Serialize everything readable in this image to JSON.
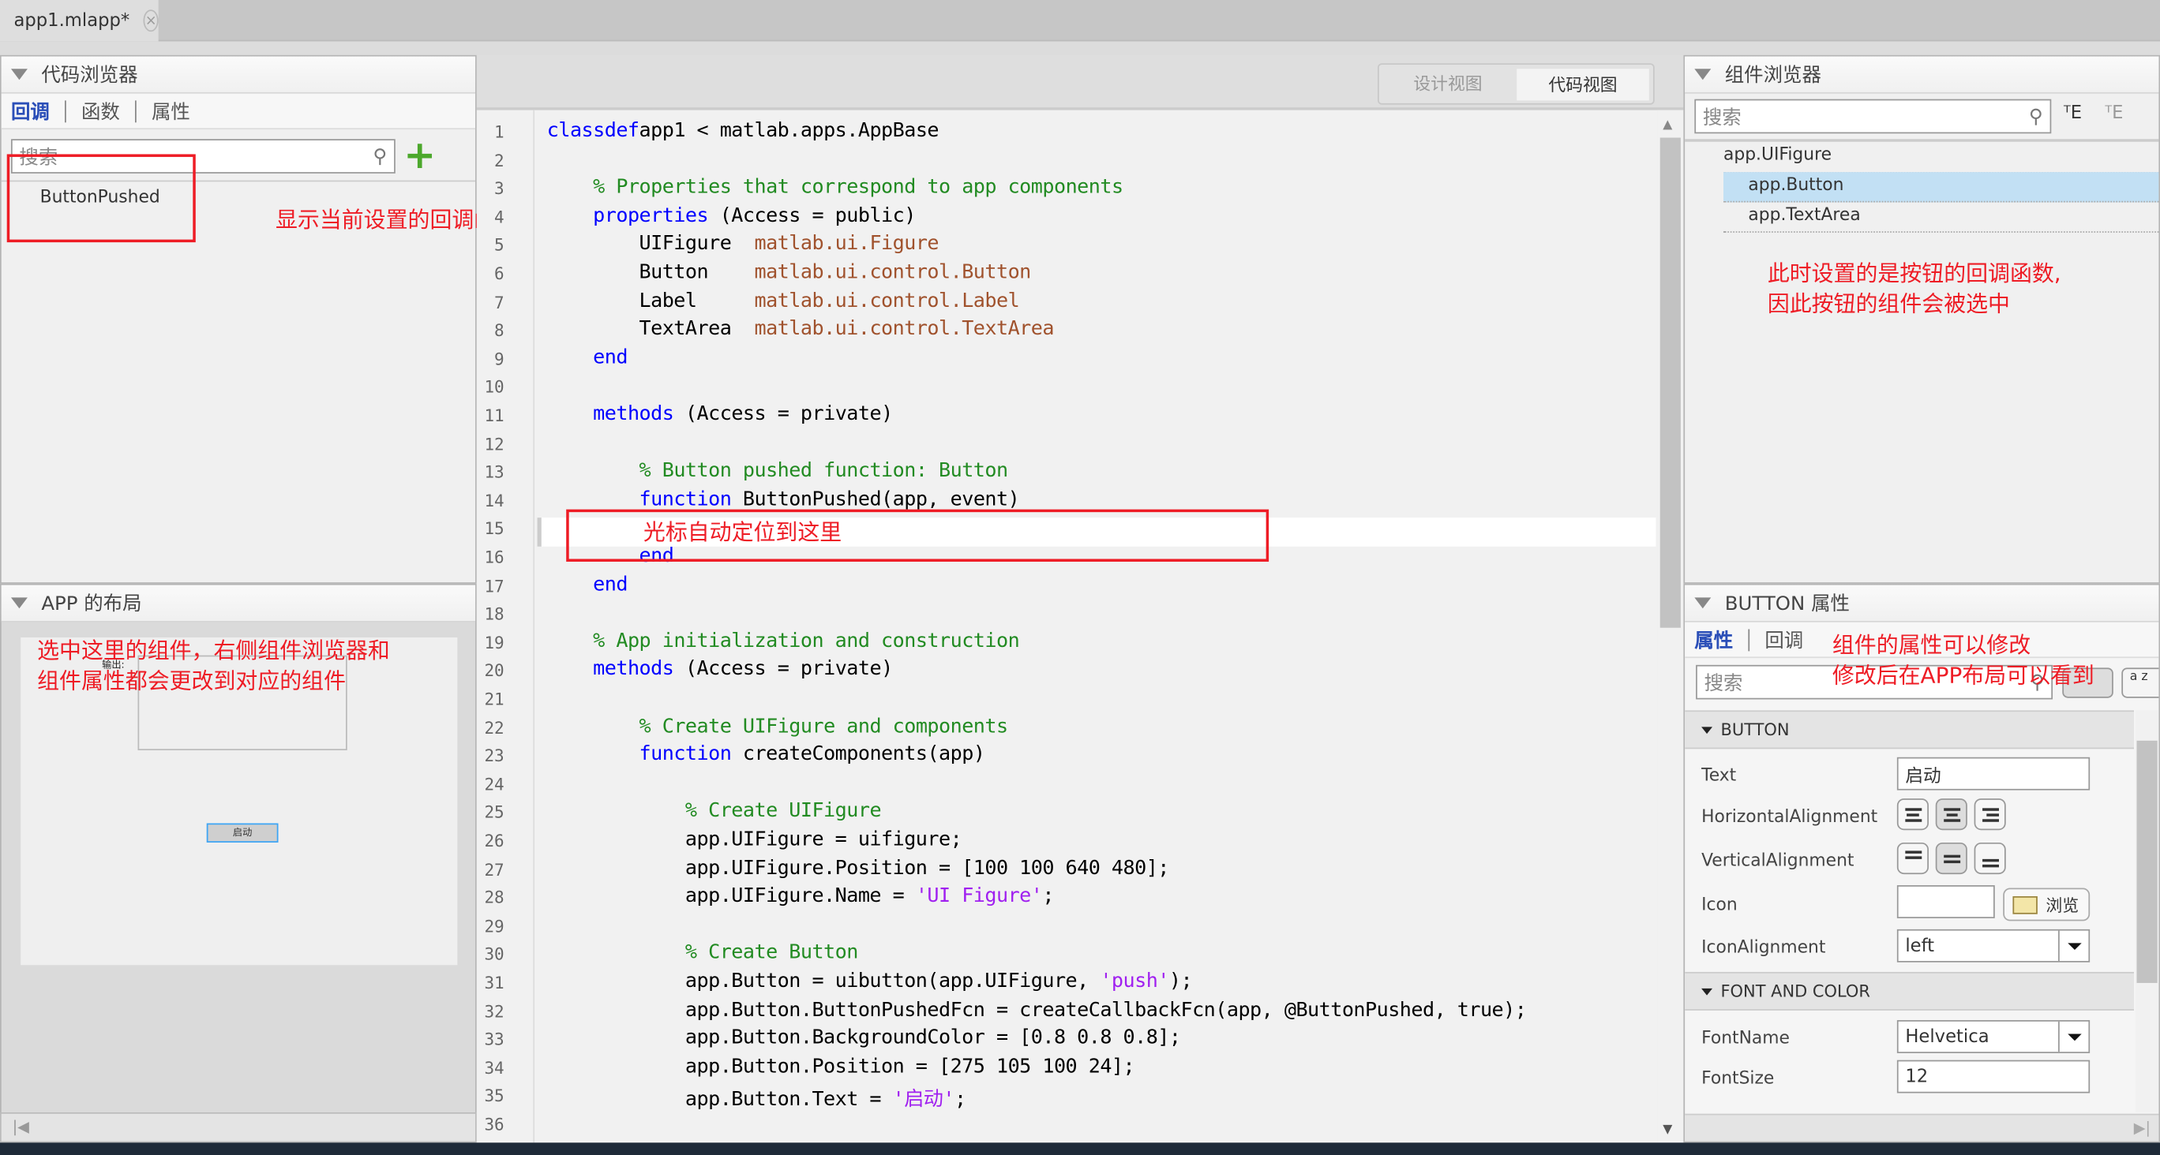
{
  "tab": {
    "title": "app1.mlapp*",
    "close": "×"
  },
  "code_browser": {
    "title": "代码浏览器",
    "tabs": [
      "回调",
      "函数",
      "属性"
    ],
    "search_placeholder": "搜索",
    "items": [
      "ButtonPushed"
    ],
    "add": "+"
  },
  "layout_panel": {
    "title": "APP 的布局",
    "label": "输出:",
    "button": "启动"
  },
  "view_toggle": {
    "design": "设计视图",
    "code": "代码视图"
  },
  "code": [
    [
      [
        "kw",
        "classdef"
      ],
      [
        "",
        "app1 < matlab.apps.AppBase"
      ]
    ],
    [],
    [
      [
        "",
        "    "
      ],
      [
        "cm",
        "% Properties that correspond to app components"
      ]
    ],
    [
      [
        "",
        "    "
      ],
      [
        "kw",
        "properties"
      ],
      [
        "",
        " (Access = public)"
      ]
    ],
    [
      [
        "",
        "        UIFigure  "
      ],
      [
        "ty",
        "matlab.ui.Figure"
      ]
    ],
    [
      [
        "",
        "        Button    "
      ],
      [
        "ty",
        "matlab.ui.control.Button"
      ]
    ],
    [
      [
        "",
        "        Label     "
      ],
      [
        "ty",
        "matlab.ui.control.Label"
      ]
    ],
    [
      [
        "",
        "        TextArea  "
      ],
      [
        "ty",
        "matlab.ui.control.TextArea"
      ]
    ],
    [
      [
        "",
        "    "
      ],
      [
        "kw",
        "end"
      ]
    ],
    [],
    [
      [
        "",
        "    "
      ],
      [
        "kw",
        "methods"
      ],
      [
        "",
        " (Access = private)"
      ]
    ],
    [],
    [
      [
        "",
        "        "
      ],
      [
        "cm",
        "% Button pushed function: Button"
      ]
    ],
    [
      [
        "",
        "        "
      ],
      [
        "kw",
        "function"
      ],
      [
        "",
        " ButtonPushed(app, event)"
      ]
    ],
    [
      [
        "",
        "            "
      ]
    ],
    [
      [
        "",
        "        "
      ],
      [
        "kw",
        "end"
      ]
    ],
    [
      [
        "",
        "    "
      ],
      [
        "kw",
        "end"
      ]
    ],
    [],
    [
      [
        "",
        "    "
      ],
      [
        "cm",
        "% App initialization and construction"
      ]
    ],
    [
      [
        "",
        "    "
      ],
      [
        "kw",
        "methods"
      ],
      [
        "",
        " (Access = private)"
      ]
    ],
    [],
    [
      [
        "",
        "        "
      ],
      [
        "cm",
        "% Create UIFigure and components"
      ]
    ],
    [
      [
        "",
        "        "
      ],
      [
        "kw",
        "function"
      ],
      [
        "",
        " createComponents(app)"
      ]
    ],
    [],
    [
      [
        "",
        "            "
      ],
      [
        "cm",
        "% Create UIFigure"
      ]
    ],
    [
      [
        "",
        "            app.UIFigure = uifigure;"
      ]
    ],
    [
      [
        "",
        "            app.UIFigure.Position = [100 100 640 480];"
      ]
    ],
    [
      [
        "",
        "            app.UIFigure.Name = "
      ],
      [
        "st",
        "'UI Figure'"
      ],
      [
        "",
        ";"
      ]
    ],
    [],
    [
      [
        "",
        "            "
      ],
      [
        "cm",
        "% Create Button"
      ]
    ],
    [
      [
        "",
        "            app.Button = uibutton(app.UIFigure, "
      ],
      [
        "st",
        "'push'"
      ],
      [
        "",
        ");"
      ]
    ],
    [
      [
        "",
        "            app.Button.ButtonPushedFcn = createCallbackFcn(app, @ButtonPushed, true);"
      ]
    ],
    [
      [
        "",
        "            app.Button.BackgroundColor = [0.8 0.8 0.8];"
      ]
    ],
    [
      [
        "",
        "            app.Button.Position = [275 105 100 24];"
      ]
    ],
    [
      [
        "",
        "            app.Button.Text = "
      ],
      [
        "st",
        "'启动'"
      ],
      [
        "",
        ";"
      ]
    ],
    []
  ],
  "component_browser": {
    "title": "组件浏览器",
    "search_placeholder": "搜索",
    "tree": [
      "app.UIFigure",
      "app.Button",
      "app.TextArea"
    ]
  },
  "inspector": {
    "title": "BUTTON 属性",
    "tabs": [
      "属性",
      "回调"
    ],
    "search_placeholder": "搜索",
    "sort_az": "a z",
    "sections": {
      "button": "BUTTON",
      "font": "FONT AND COLOR"
    },
    "props": {
      "text_label": "Text",
      "text_value": "启动",
      "halign_label": "HorizontalAlignment",
      "valign_label": "VerticalAlignment",
      "icon_label": "Icon",
      "browse": "浏览",
      "iconalign_label": "IconAlignment",
      "iconalign_value": "left",
      "fontname_label": "FontName",
      "fontname_value": "Helvetica",
      "fontsize_label": "FontSize",
      "fontsize_value": "12"
    }
  },
  "annotations": {
    "callback": "显示当前设置的回调函数",
    "cursor": "光标自动定位到这里",
    "layout1": "选中这里的组件，右侧组件浏览器和",
    "layout2": "组件属性都会更改到对应的组件",
    "browser1": "此时设置的是按钮的回调函数,",
    "browser2": "因此按钮的组件会被选中",
    "props1": "组件的属性可以修改",
    "props2": "修改后在APP布局可以看到"
  }
}
